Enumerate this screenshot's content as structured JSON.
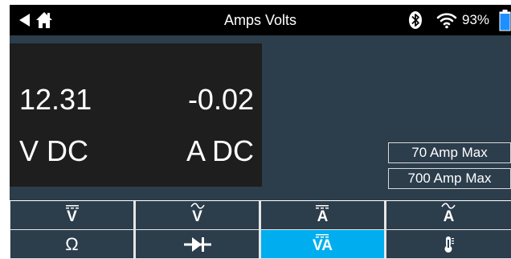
{
  "titlebar": {
    "title": "Amps Volts",
    "battery_percent": "93%",
    "battery_level": 0.93,
    "back_icon": "back-arrow-icon",
    "home_icon": "home-icon",
    "bluetooth_icon": "bluetooth-icon",
    "wifi_icon": "wifi-icon",
    "battery_icon": "battery-icon"
  },
  "readout": {
    "voltage_value": "12.31",
    "current_value": "-0.02",
    "voltage_unit": "V DC",
    "current_unit": "A DC"
  },
  "range_buttons": {
    "amp70": "70 Amp Max",
    "amp700": "700 Amp Max"
  },
  "mode_grid": {
    "v_dc": "V",
    "v_ac": "V",
    "a_dc": "A",
    "a_ac": "A",
    "ohms": "Ω",
    "diode_icon": "diode-icon",
    "va_dc": "VA",
    "temp_icon": "thermometer-icon",
    "active_mode": "va_dc"
  },
  "colors": {
    "titlebar_bg": "#000000",
    "panel_bg": "#2c3d4c",
    "readout_bg": "#1e1e1e",
    "active_bg": "#00aeef",
    "grid_line": "#e6e6e6",
    "battery_fill": "#1e8fff"
  }
}
